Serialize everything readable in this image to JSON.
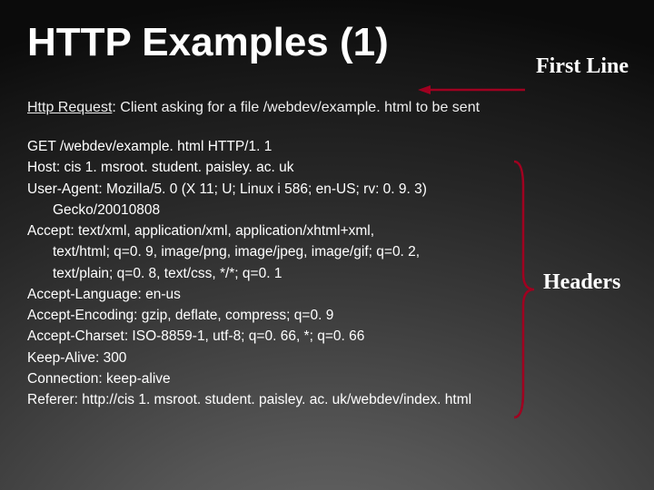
{
  "title": "HTTP Examples (1)",
  "first_line_label": "First Line",
  "headers_label": "Headers",
  "subtitle_label": "Http Request",
  "subtitle_text": ": Client asking for a file /webdev/example. html to be sent",
  "lines": {
    "l0": "GET /webdev/example. html HTTP/1. 1",
    "l1": "Host: cis 1. msroot. student. paisley. ac. uk",
    "l2": "User-Agent: Mozilla/5. 0 (X 11; U; Linux i 586; en-US; rv: 0. 9. 3)",
    "l2b": "Gecko/20010808",
    "l3": "Accept: text/xml, application/xml, application/xhtml+xml,",
    "l3b": "text/html; q=0. 9, image/png, image/jpeg, image/gif; q=0. 2,",
    "l3c": "text/plain; q=0. 8, text/css, */*; q=0. 1",
    "l4": "Accept-Language: en-us",
    "l5": "Accept-Encoding: gzip, deflate, compress; q=0. 9",
    "l6": "Accept-Charset: ISO-8859-1, utf-8; q=0. 66, *; q=0. 66",
    "l7": "Keep-Alive: 300",
    "l8": "Connection: keep-alive",
    "l9": "Referer: http://cis 1. msroot. student. paisley. ac. uk/webdev/index. html"
  },
  "colors": {
    "arrow": "#a00020",
    "brace": "#a00020"
  }
}
